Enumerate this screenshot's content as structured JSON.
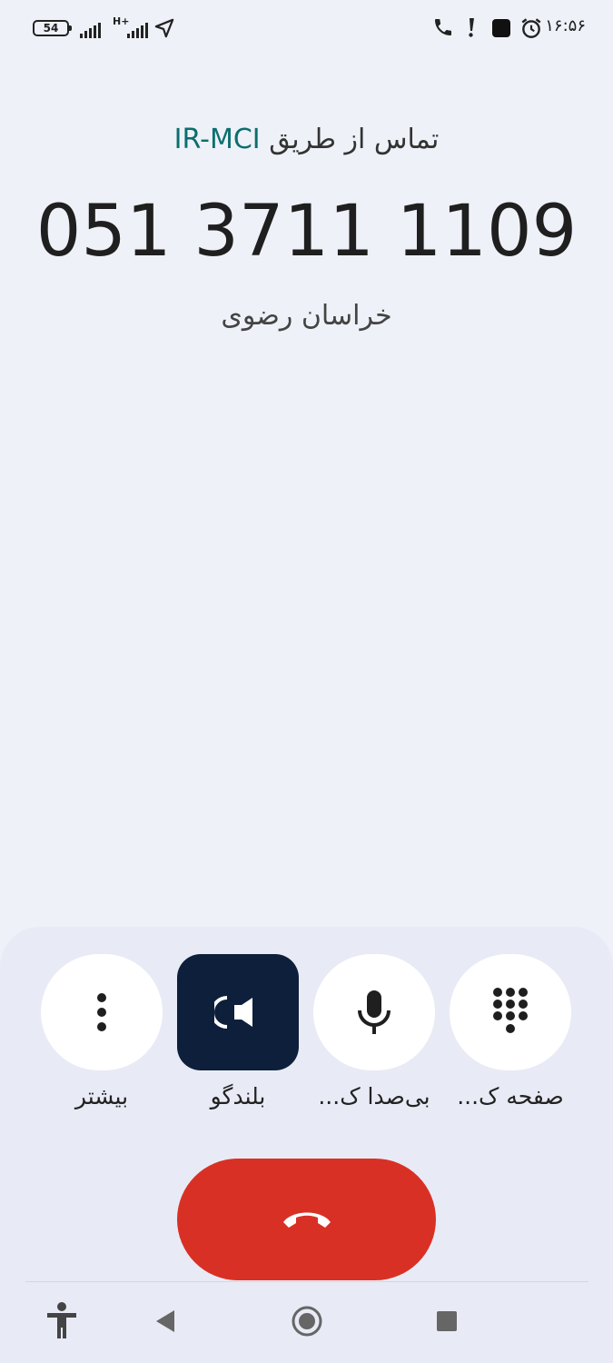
{
  "status_bar": {
    "battery": "54",
    "network_type": "H+",
    "clock": "۱۶:۵۶",
    "icons": [
      "battery-icon",
      "signal-icon",
      "signal-icon",
      "navigation-icon",
      "phone-icon",
      "alert-icon",
      "square-app-icon",
      "alarm-icon"
    ]
  },
  "call": {
    "via_prefix": "تماس از طریق",
    "carrier": "IR-MCI",
    "number": "051 3711 1109",
    "location": "خراسان رضوی"
  },
  "controls": [
    {
      "label": "بیشتر",
      "icon": "more-vert-icon"
    },
    {
      "label": "بلندگو",
      "icon": "speaker-icon",
      "active": true
    },
    {
      "label": "بی‌صدا ک...",
      "icon": "mic-icon"
    },
    {
      "label": "صفحه ک...",
      "icon": "dialpad-icon"
    }
  ],
  "end_call": {
    "icon": "end-call-icon"
  },
  "nav": [
    "accessibility-icon",
    "back-icon",
    "home-icon",
    "recents-icon"
  ],
  "colors": {
    "background": "#eef1f8",
    "carrier": "#0b6e6e",
    "end_call": "#d93025",
    "speaker_active": "#0d1f3a"
  }
}
